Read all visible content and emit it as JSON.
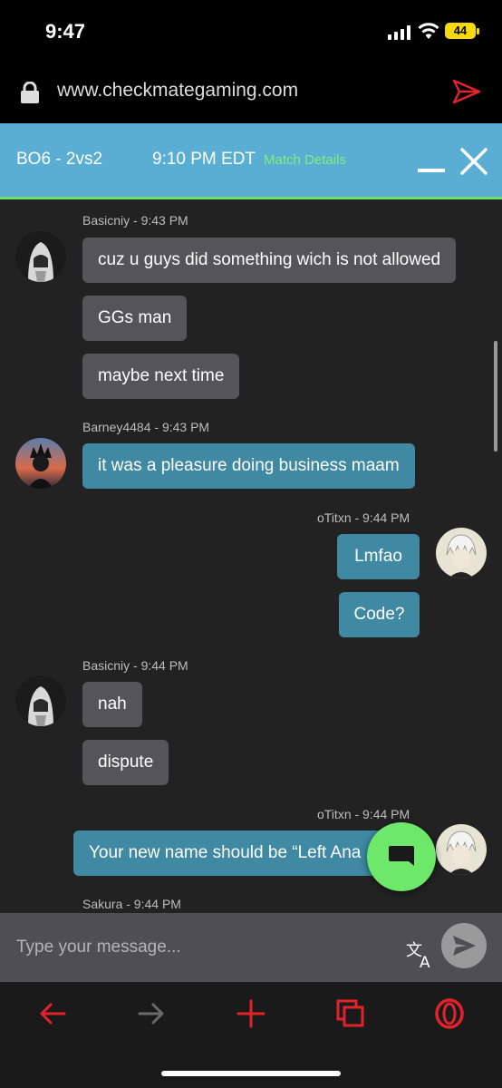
{
  "status_bar": {
    "time": "9:47",
    "battery": "44"
  },
  "browser": {
    "url": "www.checkmategaming.com"
  },
  "header": {
    "game_title": "BO6 - 2vs2",
    "match_time": "9:10 PM EDT",
    "match_details_link": "Match Details"
  },
  "messages": [
    {
      "meta": "Basicniy - 9:43 PM",
      "side": "left",
      "bubbles": [
        "cuz u guys did something wich is not allowed",
        "GGs man",
        "maybe next time"
      ]
    },
    {
      "meta": "Barney4484 - 9:43 PM",
      "side": "left",
      "bubbles": [
        "it was a pleasure doing business maam"
      ]
    },
    {
      "meta": "oTitxn - 9:44 PM",
      "side": "right",
      "bubbles": [
        "Lmfao",
        "Code?"
      ]
    },
    {
      "meta": "Basicniy - 9:44 PM",
      "side": "left",
      "bubbles": [
        "nah",
        "dispute"
      ]
    },
    {
      "meta": "oTitxn - 9:44 PM",
      "side": "right",
      "bubbles": [
        "Your new name should be “Left Ana"
      ]
    },
    {
      "meta": "Sakura - 9:44 PM",
      "side": "left",
      "bubbles": []
    }
  ],
  "composer": {
    "placeholder": "Type your message..."
  },
  "colors": {
    "header": "#5aaed3",
    "accent_green": "#6ee06a",
    "own_bubble": "#3f89a3",
    "other_bubble": "#555557",
    "toolbar_red": "#e0232b"
  },
  "icons": {
    "url_bar": [
      "lock-icon",
      "send-icon"
    ],
    "header": [
      "minimize-icon",
      "close-icon"
    ],
    "composer": [
      "translate-icon",
      "send-icon"
    ],
    "toolbar": [
      "back-arrow-icon",
      "forward-arrow-icon",
      "new-tab-plus-icon",
      "tabs-icon",
      "opera-icon"
    ],
    "fab": "chat-bubble-icon"
  }
}
